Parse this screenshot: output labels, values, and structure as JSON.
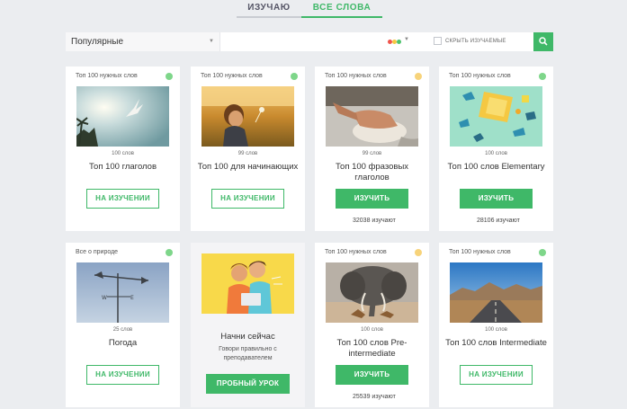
{
  "tabs": [
    {
      "label": "ИЗУЧАЮ",
      "active": false
    },
    {
      "label": "ВСЕ СЛОВА",
      "active": true
    }
  ],
  "filters": {
    "sort_value": "Популярные",
    "search_placeholder": "",
    "hide_learning_label": "СКРЫТЬ ИЗУЧАЕМЫЕ",
    "level_dot_colors": [
      "#f0554c",
      "#f5c842",
      "#4fc36e"
    ]
  },
  "colors": {
    "accent": "#3fb868",
    "status_green": "#7ed68a",
    "status_yellow": "#f7d37a"
  },
  "cards": [
    {
      "category": "Топ 100 нужных слов",
      "status": "green",
      "image": "bird-sky",
      "count": "100 слов",
      "title": "Топ 100 глаголов",
      "button": "НА ИЗУЧЕНИИ",
      "button_style": "outline",
      "learners": ""
    },
    {
      "category": "Топ 100 нужных слов",
      "status": "green",
      "image": "child-field",
      "count": "99 слов",
      "title": "Топ 100 для начинающих",
      "button": "НА ИЗУЧЕНИИ",
      "button_style": "outline",
      "learners": ""
    },
    {
      "category": "Топ 100 нужных слов",
      "status": "yellow",
      "image": "hands-dough",
      "count": "99 слов",
      "title": "Топ 100 фразовых глаголов",
      "button": "ИЗУЧИТЬ",
      "button_style": "solid",
      "learners": "32038 изучают"
    },
    {
      "category": "Топ 100 нужных слов",
      "status": "green",
      "image": "toys",
      "count": "100 слов",
      "title": "Топ 100 слов Elementary",
      "button": "ИЗУЧИТЬ",
      "button_style": "solid",
      "learners": "28106 изучают"
    },
    {
      "category": "Все о природе",
      "status": "green",
      "image": "weathervane",
      "count": "25 слов",
      "title": "Погода",
      "button": "НА ИЗУЧЕНИИ",
      "button_style": "outline",
      "learners": ""
    },
    {
      "category": "",
      "status": "",
      "image": "promo-people",
      "count": "",
      "title": "Начни сейчас",
      "subtitle": "Говори правильно с преподавателем",
      "button": "ПРОБНЫЙ УРОК",
      "button_style": "solid",
      "learners": ""
    },
    {
      "category": "Топ 100 нужных слов",
      "status": "yellow",
      "image": "elephants",
      "count": "100 слов",
      "title": "Топ 100 слов Pre-intermediate",
      "button": "ИЗУЧИТЬ",
      "button_style": "solid",
      "learners": "25539 изучают"
    },
    {
      "category": "Топ 100 нужных слов",
      "status": "green",
      "image": "road-mountains",
      "count": "100 слов",
      "title": "Топ 100 слов Intermediate",
      "button": "НА ИЗУЧЕНИИ",
      "button_style": "outline",
      "learners": ""
    }
  ]
}
